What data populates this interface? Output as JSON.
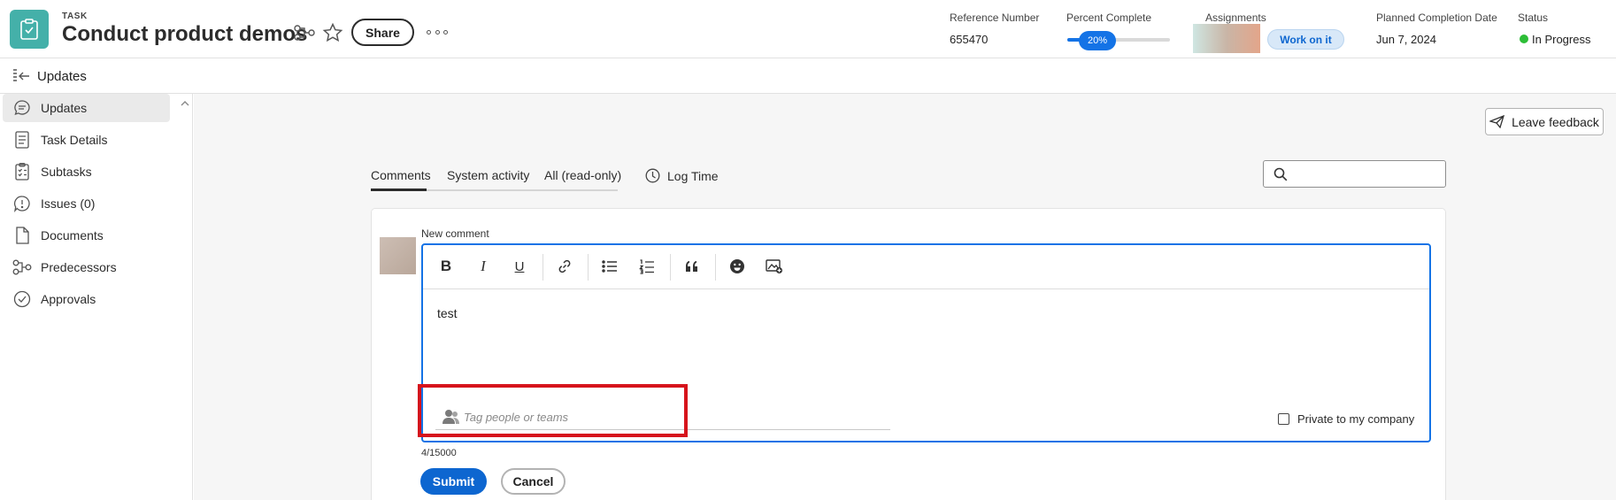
{
  "header": {
    "type_label": "TASK",
    "title": "Conduct product demos",
    "share_label": "Share",
    "icons": [
      "task-icon",
      "dependency-icon",
      "star-icon",
      "more-icon"
    ],
    "reference_number": {
      "label": "Reference Number",
      "value": "655470"
    },
    "percent_complete": {
      "label": "Percent Complete",
      "value_text": "20%",
      "value": 0.2
    },
    "assignments": {
      "label": "Assignments",
      "work_on_it_label": "Work on it"
    },
    "planned_completion": {
      "label": "Planned Completion Date",
      "value": "Jun 7, 2024"
    },
    "status": {
      "label": "Status",
      "value": "In Progress",
      "color": "#2dbe37"
    }
  },
  "updates_bar": {
    "title": "Updates"
  },
  "sidebar": {
    "items": [
      {
        "label": "Updates",
        "icon": "comment-icon",
        "active": true
      },
      {
        "label": "Task Details",
        "icon": "document-lines-icon",
        "active": false
      },
      {
        "label": "Subtasks",
        "icon": "checklist-icon",
        "active": false
      },
      {
        "label": "Issues (0)",
        "icon": "issue-icon",
        "active": false
      },
      {
        "label": "Documents",
        "icon": "file-icon",
        "active": false
      },
      {
        "label": "Predecessors",
        "icon": "dependency-icon",
        "active": false
      },
      {
        "label": "Approvals",
        "icon": "check-circle-icon",
        "active": false
      }
    ]
  },
  "main": {
    "feedback_label": "Leave feedback",
    "tabs": [
      {
        "label": "Comments",
        "active": true
      },
      {
        "label": "System activity",
        "active": false
      },
      {
        "label": "All (read-only)",
        "active": false
      }
    ],
    "log_time_label": "Log Time",
    "search": {
      "value": ""
    },
    "comment": {
      "label": "New comment",
      "toolbar": [
        "bold-icon",
        "italic-icon",
        "underline-icon",
        "link-icon",
        "bulleted-list-icon",
        "numbered-list-icon",
        "quote-icon",
        "emoji-icon",
        "insert-image-icon"
      ],
      "text": "test",
      "tag_placeholder": "Tag people or teams",
      "private_label": "Private to my company",
      "private_checked": false,
      "char_count": "4/15000",
      "submit_label": "Submit",
      "cancel_label": "Cancel"
    }
  },
  "colors": {
    "accent": "#1473e6",
    "primary_button": "#0d66d0",
    "task_icon_bg": "#44b0a9",
    "highlight": "#d6141c"
  }
}
